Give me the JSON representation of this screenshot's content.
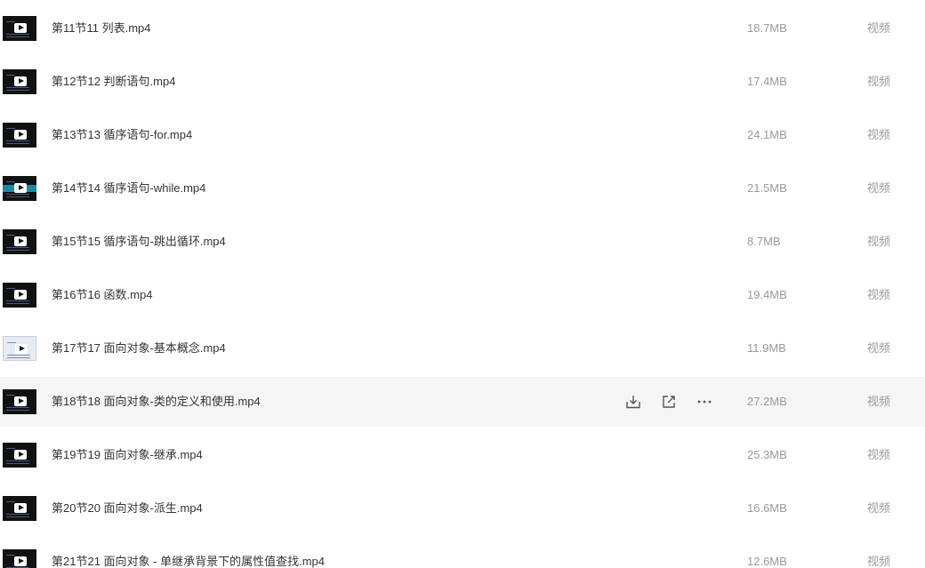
{
  "files": [
    {
      "name": "第11节11 列表.mp4",
      "size": "18.7MB",
      "type": "视频",
      "thumb": "dark"
    },
    {
      "name": "第12节12 判断语句.mp4",
      "size": "17.4MB",
      "type": "视频",
      "thumb": "dark"
    },
    {
      "name": "第13节13 循序语句-for.mp4",
      "size": "24.1MB",
      "type": "视频",
      "thumb": "dark"
    },
    {
      "name": "第14节14 循序语句-while.mp4",
      "size": "21.5MB",
      "type": "视频",
      "thumb": "teal"
    },
    {
      "name": "第15节15 循序语句-跳出循环.mp4",
      "size": "8.7MB",
      "type": "视频",
      "thumb": "dark"
    },
    {
      "name": "第16节16 函数.mp4",
      "size": "19.4MB",
      "type": "视频",
      "thumb": "dark"
    },
    {
      "name": "第17节17 面向对象-基本概念.mp4",
      "size": "11.9MB",
      "type": "视频",
      "thumb": "light"
    },
    {
      "name": "第18节18 面向对象-类的定义和使用.mp4",
      "size": "27.2MB",
      "type": "视频",
      "thumb": "dark",
      "hovered": true
    },
    {
      "name": "第19节19 面向对象-继承.mp4",
      "size": "25.3MB",
      "type": "视频",
      "thumb": "dark"
    },
    {
      "name": "第20节20 面向对象-派生.mp4",
      "size": "16.6MB",
      "type": "视频",
      "thumb": "dark"
    },
    {
      "name": "第21节21 面向对象 - 单继承背景下的属性值查找.mp4",
      "size": "12.6MB",
      "type": "视频",
      "thumb": "dark"
    }
  ],
  "row_actions": {
    "download_icon": "download-icon",
    "share_icon": "share-icon",
    "more_icon": "more-icon"
  },
  "colors": {
    "name_text": "#333333",
    "meta_text": "#999999",
    "hover_bg": "#f5f5f6",
    "teal_stripe": "#1f8a9a"
  }
}
